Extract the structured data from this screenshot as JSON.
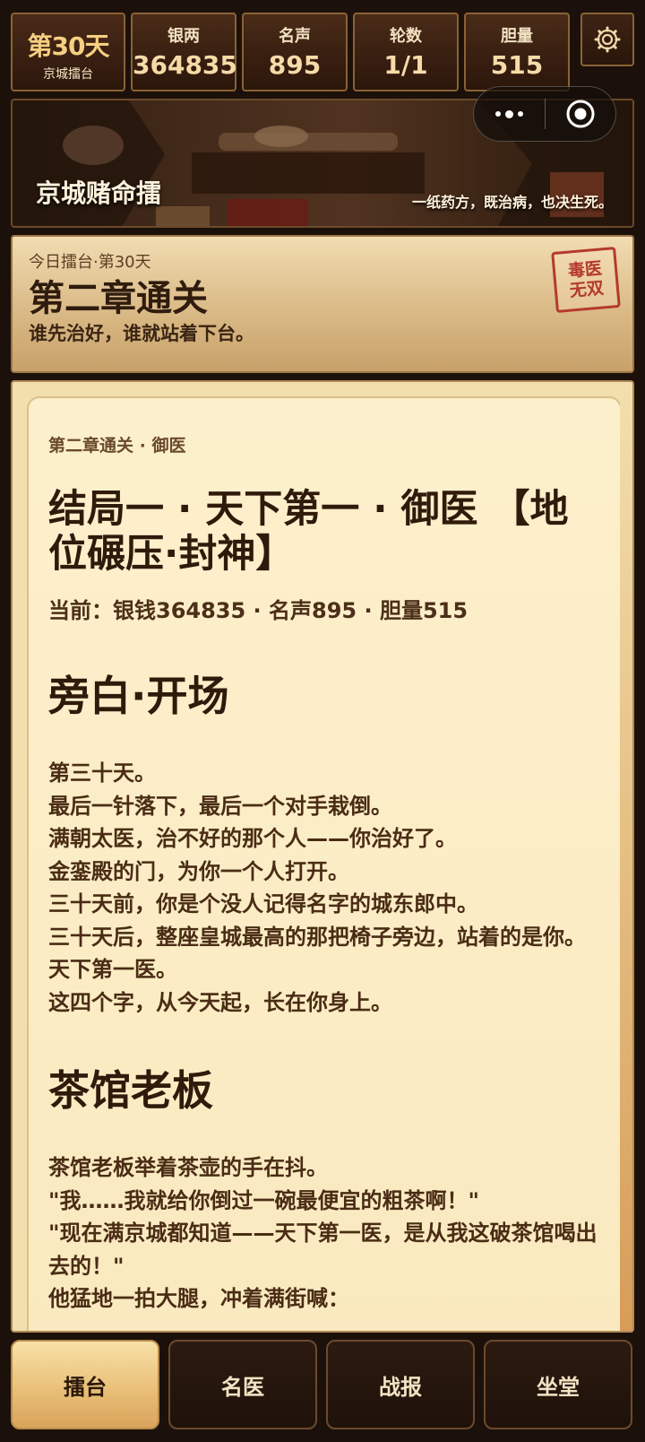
{
  "topbar": {
    "day": "第30天",
    "day_sub": "京城擂台",
    "stats": [
      {
        "label": "银两",
        "value": "364835"
      },
      {
        "label": "名声",
        "value": "895"
      },
      {
        "label": "轮数",
        "value": "1/1"
      },
      {
        "label": "胆量",
        "value": "515"
      }
    ],
    "settings_icon": "gear-icon"
  },
  "banner": {
    "title": "京城赌命擂",
    "tagline": "一纸药方，既治病，也决生死。"
  },
  "capsule": {
    "more_icon": "more-dots-icon",
    "close_icon": "target-close-icon"
  },
  "arena": {
    "small": "今日擂台·第30天",
    "title": "第二章通关",
    "motto": "谁先治好，谁就站着下台。",
    "stamp_line1": "毒医",
    "stamp_line2": "无双"
  },
  "story": {
    "kicker": "第二章通关 · 御医",
    "ending": "结局一 · 天下第一 · 御医 【地位碾压·封神】",
    "current": "当前：银钱364835 · 名声895 · 胆量515",
    "sections": [
      {
        "heading": "旁白·开场",
        "lines": [
          "第三十天。",
          "最后一针落下，最后一个对手栽倒。",
          "满朝太医，治不好的那个人——你治好了。",
          "金銮殿的门，为你一个人打开。",
          "三十天前，你是个没人记得名字的城东郎中。",
          "三十天后，整座皇城最高的那把椅子旁边，站着的是你。",
          "天下第一医。",
          "这四个字，从今天起，长在你身上。"
        ]
      },
      {
        "heading": "茶馆老板",
        "lines": [
          "茶馆老板举着茶壶的手在抖。",
          "\"我……我就给你倒过一碗最便宜的粗茶啊！\"",
          "\"现在满京城都知道——天下第一医，是从我这破茶馆喝出去的！\"",
          "他猛地一拍大腿，冲着满街喊："
        ]
      }
    ]
  },
  "nav": {
    "tabs": [
      "擂台",
      "名医",
      "战报",
      "坐堂"
    ],
    "active_index": 0
  },
  "colors": {
    "accent_gold": "#e8bd74",
    "dark_wood": "#2c1a10",
    "parchment": "#fcf0cc",
    "stamp_red": "#b43a2c"
  }
}
